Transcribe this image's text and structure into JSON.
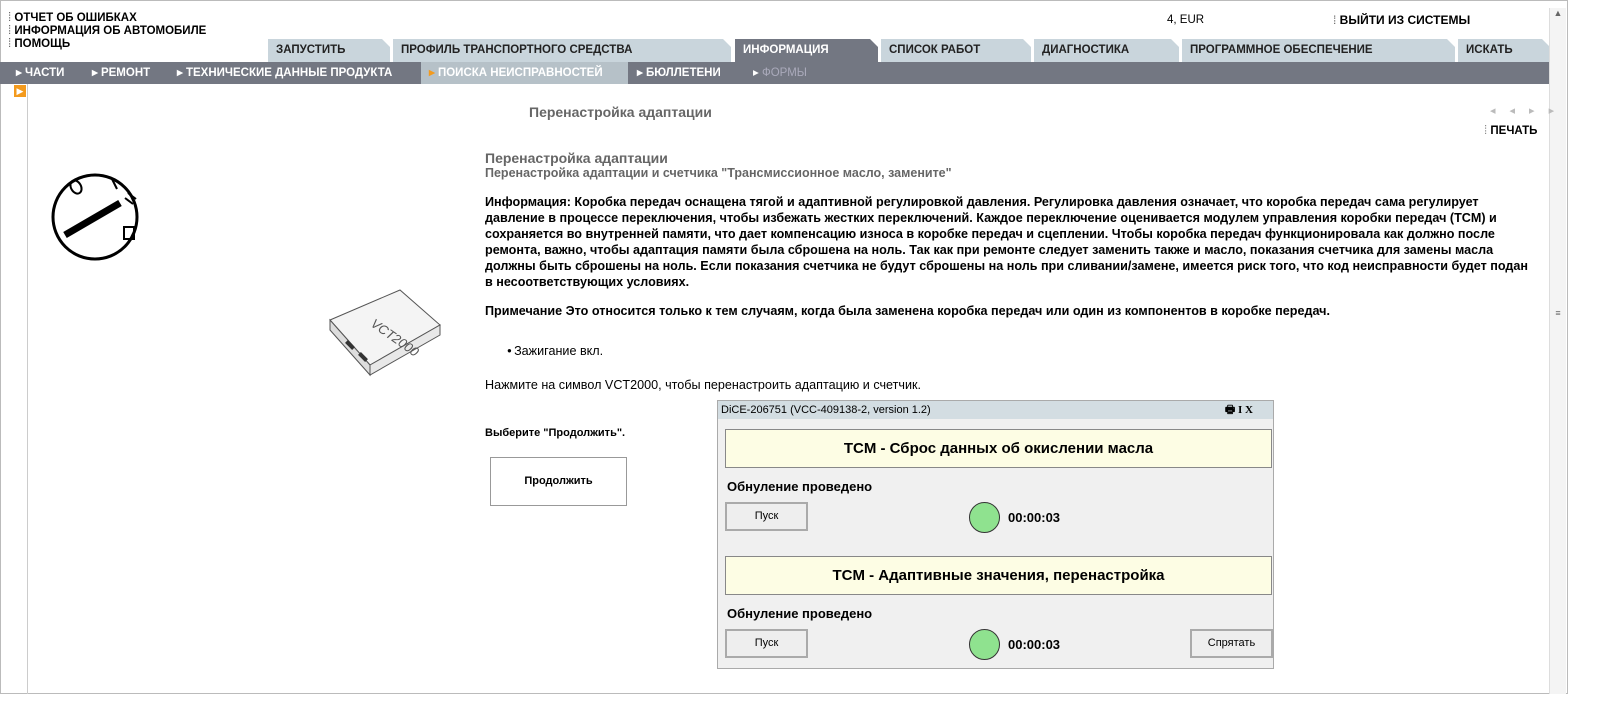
{
  "top_links": [
    "ОТЧЕТ ОБ ОШИБКАХ",
    "ИНФОРМАЦИЯ ОБ АВТОМОБИЛЕ",
    "ПОМОЩЬ"
  ],
  "currency": "4, EUR",
  "logout": "ВЫЙТИ ИЗ СИСТЕМЫ",
  "tabs": [
    "ЗАПУСТИТЬ",
    "ПРОФИЛЬ ТРАНСПОРТНОГО СРЕДСТВА",
    "ИНФОРМАЦИЯ",
    "СПИСОК РАБОТ",
    "ДИАГНОСТИКА",
    "ПРОГРАММНОЕ ОБЕСПЕЧЕНИЕ",
    "ИСКАТЬ"
  ],
  "subnav": [
    "ЧАСТИ",
    "РЕМОНТ",
    "ТЕХНИЧЕСКИЕ ДАННЫЕ ПРОДУКТА",
    "ПОИСКА НЕИСПРАВНОСТЕЙ",
    "БЮЛЛЕТЕНИ",
    "ФОРМЫ"
  ],
  "page_heading": "Перенастройка адаптации",
  "print": "ПЕЧАТЬ",
  "content": {
    "title": "Перенастройка адаптации",
    "subtitle": "Перенастройка адаптации и счетчика \"Трансмиссионное масло, замените\"",
    "info": "Информация: Коробка передач оснащена тягой и адаптивной регулировкой давления. Регулировка давления означает, что коробка передач сама регулирует давление в процессе переключения, чтобы избежать жестких переключений. Каждое переключение оценивается модулем управления коробки передач (TCM) и сохраняется во внутренней памяти, что дает компенсацию износа в коробке передач и сцеплении. Чтобы коробка передач функционировала как должно после ремонта, важно, чтобы адаптация памяти была сброшена на ноль. Так как при ремонте следует заменить также и масло, показания счетчика для замены масла должны быть сброшены на ноль. Если показания счетчика не будут сброшены на ноль при сливании/замене, имеется риск того, что код неисправности будет подан в несоответствующих условиях.",
    "note": "Примечание Это относится только к тем случаям, когда была заменена коробка передач или один из компонентов в коробке передач.",
    "bullet": "Зажигание вкл.",
    "instruction": "Нажмите на символ VCT2000, чтобы перенастроить адаптацию и счетчик.",
    "choose": "Выберите \"Продолжить\".",
    "continue": "Продолжить",
    "vct_label": "VCT2000"
  },
  "dialog": {
    "title": "DiCE-206751   (VCC-409138-2, version 1.2)",
    "icons": "I  X",
    "sections": [
      {
        "title": "TCM - Сброс данных об окислении масла",
        "status": "Обнуление проведено",
        "button": "Пуск",
        "time": "00:00:03",
        "led_color": "#8fe28f"
      },
      {
        "title": "TCM - Адаптивные значения, перенастройка",
        "status": "Обнуление проведено",
        "button": "Пуск",
        "time": "00:00:03",
        "led_color": "#8fe28f"
      }
    ],
    "hide": "Спрятать"
  }
}
